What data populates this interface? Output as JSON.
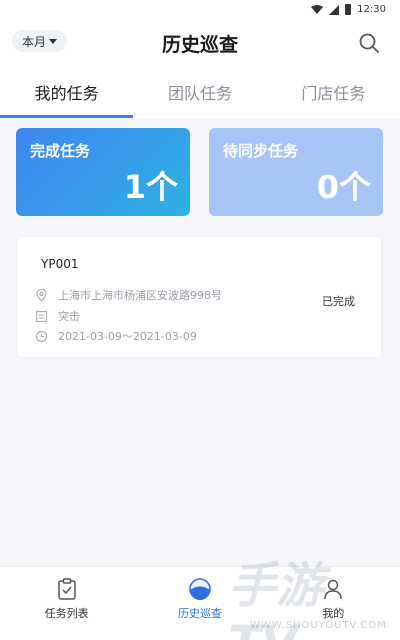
{
  "status_bar": {
    "time": "12:30"
  },
  "header": {
    "month_filter": "本月",
    "title": "历史巡查"
  },
  "tabs": [
    {
      "label": "我的任务",
      "active": true
    },
    {
      "label": "团队任务",
      "active": false
    },
    {
      "label": "门店任务",
      "active": false
    }
  ],
  "stats": {
    "completed": {
      "label": "完成任务",
      "value": "1个"
    },
    "pending_sync": {
      "label": "待同步任务",
      "value": "0个"
    }
  },
  "task": {
    "id": "YP001",
    "address": "上海市上海市杨浦区安波路998号",
    "type": "突击",
    "date_range": "2021-03-09～2021-03-09",
    "status": "已完成"
  },
  "bottom_nav": [
    {
      "label": "任务列表",
      "icon": "clipboard-check-icon",
      "active": false
    },
    {
      "label": "历史巡查",
      "icon": "history-icon",
      "active": true
    },
    {
      "label": "我的",
      "icon": "user-icon",
      "active": false
    }
  ],
  "watermark": {
    "text": "手游TV",
    "url": "WWW.SHOUYOUTV.COM"
  },
  "colors": {
    "accent": "#3f7ee8",
    "card_done_start": "#3f86f0",
    "card_done_end": "#2fb1e4",
    "card_pending": "#a8c6f5"
  }
}
